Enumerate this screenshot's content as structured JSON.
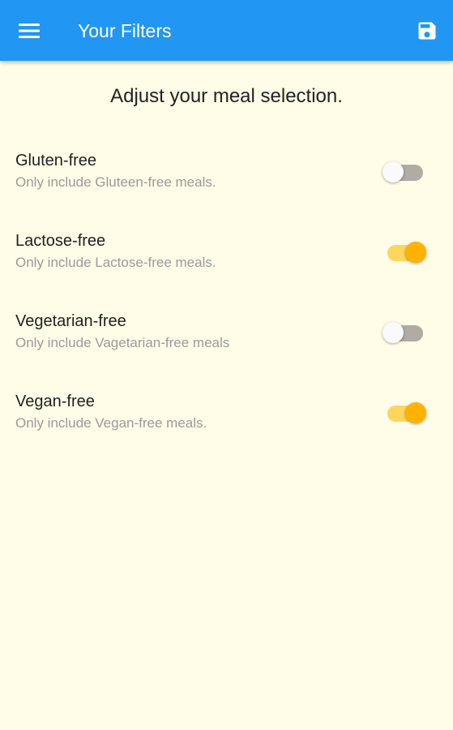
{
  "app_bar": {
    "title": "Your Filters",
    "menu_icon": "menu-icon",
    "save_icon": "save-icon",
    "color": "#2196f3"
  },
  "heading": "Adjust your meal selection.",
  "filters": [
    {
      "title": "Gluten-free",
      "subtitle": "Only include Gluteen-free meals.",
      "enabled": false
    },
    {
      "title": "Lactose-free",
      "subtitle": "Only include Lactose-free meals.",
      "enabled": true
    },
    {
      "title": "Vegetarian-free",
      "subtitle": "Only include Vagetarian-free meals",
      "enabled": false
    },
    {
      "title": "Vegan-free",
      "subtitle": "Only include Vegan-free meals.",
      "enabled": true
    }
  ],
  "colors": {
    "background": "#fffde7",
    "switch_on_thumb": "#ffb300",
    "switch_on_track": "#ffd65c",
    "switch_off_track": "#b0aca4"
  }
}
